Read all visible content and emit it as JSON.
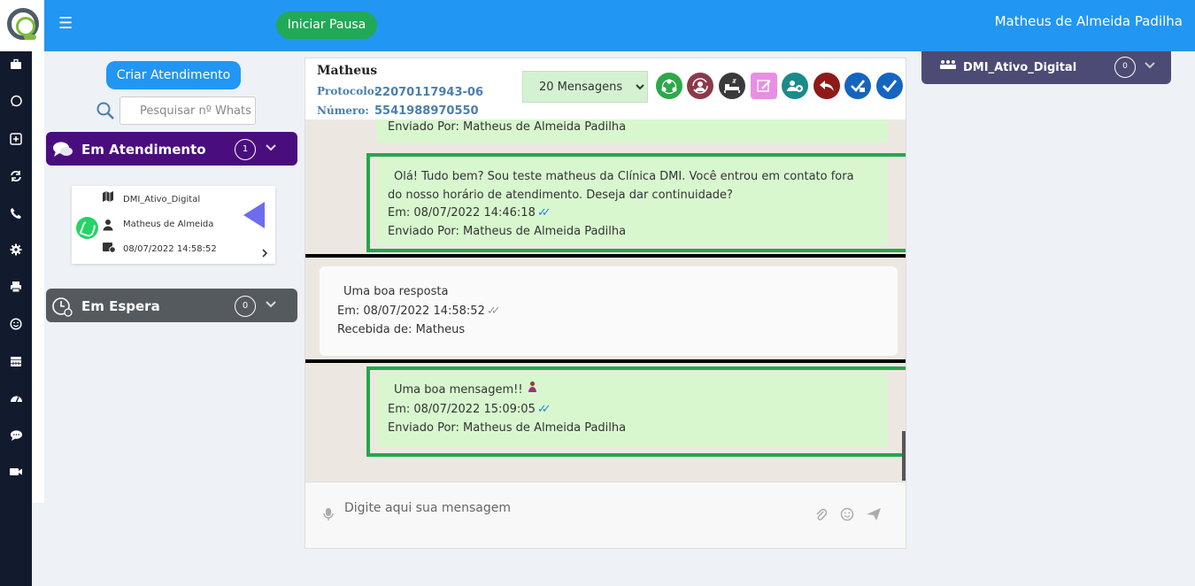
{
  "topbar": {
    "pause_button": "Iniciar Pausa",
    "user_name": "Matheus de Almeida Padilha"
  },
  "sidenav": {
    "icons": [
      "briefcase-icon",
      "whatsapp-icon",
      "plus-square-icon",
      "sync-icon",
      "phone-icon",
      "gear-icon",
      "print-icon",
      "smile-icon",
      "calendar-icon",
      "dashboard-icon",
      "chat-icon",
      "video-icon"
    ]
  },
  "left": {
    "create_button": "Criar Atendimento",
    "search_placeholder": "Pesquisar nº Whats",
    "in_service": {
      "title": "Em Atendimento",
      "count": "1",
      "card": {
        "queue": "DMI_Ativo_Digital",
        "agent": "Matheus de Almeida",
        "datetime": "08/07/2022 14:58:52"
      }
    },
    "waiting": {
      "title": "Em Espera",
      "count": "0"
    }
  },
  "chat": {
    "contact_name": "Matheus",
    "protocol_label": "Protocolo:",
    "protocol_value": "22070117943-06",
    "number_label": "Número:",
    "number_value": "5541988970550",
    "messages_filter": "20 Mensagens",
    "filter_options": [
      "20 Mensagens"
    ],
    "action_colors": [
      "#2ea84a",
      "#8a3a4a",
      "#3a3a3a",
      "#e88fe5",
      "#1d8a8a",
      "#8f1a1a",
      "#1565c0",
      "#1565c0"
    ],
    "messages": [
      {
        "type": "sent",
        "sender_line": "Enviado Por: Matheus de Almeida Padilha"
      },
      {
        "type": "sent",
        "text": "Olá! Tudo bem? Sou teste matheus da Clínica DMI. Você entrou em contato fora do nosso horário de atendimento. Deseja dar continuidade?",
        "time_line": "Em: 08/07/2022 14:46:18",
        "sender_line": "Enviado Por: Matheus de Almeida Padilha"
      },
      {
        "type": "received",
        "text": "Uma boa resposta",
        "time_line": "Em: 08/07/2022 14:58:52",
        "sender_line": "Recebida de: Matheus"
      },
      {
        "type": "sent",
        "text": "Uma boa mensagem!!",
        "time_line": "Em: 08/07/2022 15:09:05",
        "sender_line": "Enviado Por: Matheus de Almeida Padilha"
      }
    ],
    "composer_placeholder": "Digite aqui sua mensagem"
  },
  "queue_chip": {
    "title": "DMI_Ativo_Digital",
    "count": "0"
  }
}
